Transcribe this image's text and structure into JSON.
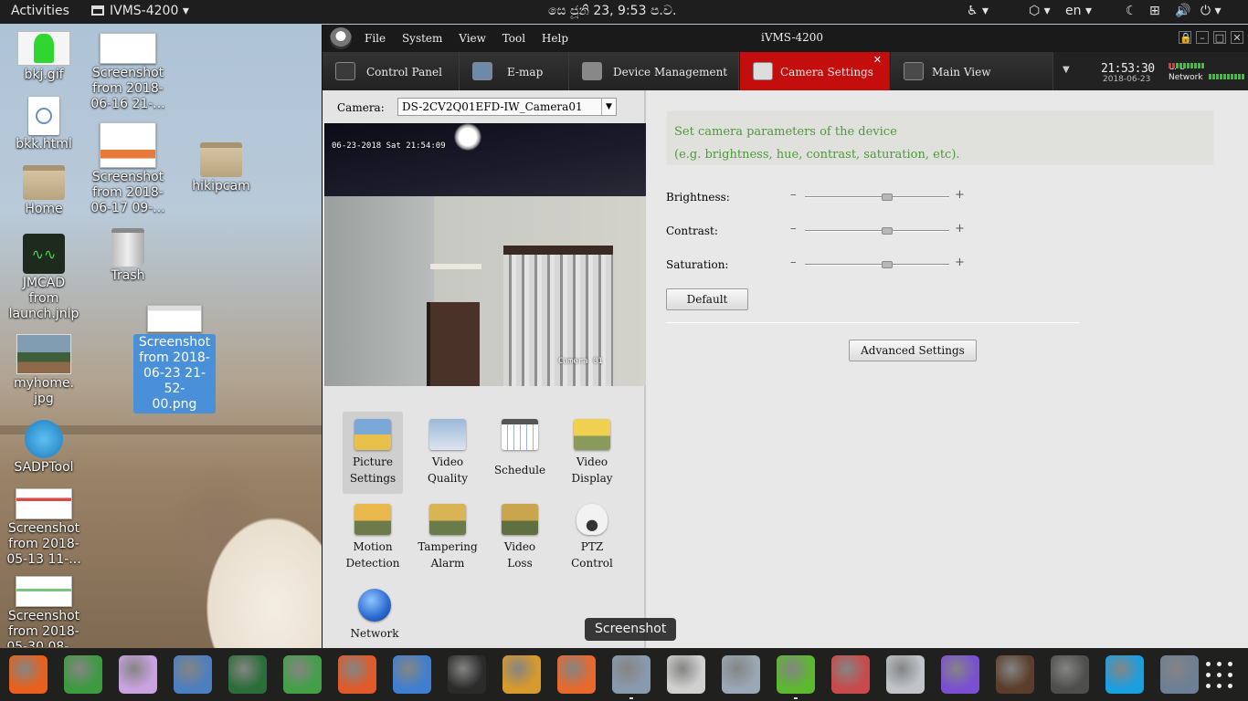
{
  "topbar": {
    "activities": "Activities",
    "app_name": "IVMS-4200",
    "app_menu_arrow": "▾",
    "clock": "සෙ ජූනි  23,  9:53 ප.ව.",
    "lang": "en",
    "lang_arrow": "▾",
    "tray_glyphs": {
      "accessibility": "♿ ▾",
      "dropbox": "⬡ ▾",
      "night": "☾",
      "network": "⊞",
      "volume": "🔊",
      "power": "⏻ ▾"
    }
  },
  "desktop": {
    "icons": [
      {
        "label": "bkj.gif",
        "icon": "image-icon"
      },
      {
        "label": "bkk.html",
        "icon": "html-file-icon"
      },
      {
        "label": "Home",
        "icon": "home-folder-icon"
      },
      {
        "label": "JMCAD\nfrom\nlaunch.jnlp",
        "icon": "jmcad-icon"
      },
      {
        "label": "myhome.\njpg",
        "icon": "photo-icon"
      },
      {
        "label": "SADPTool",
        "icon": "sadptool-icon"
      },
      {
        "label": "Screenshot\nfrom 2018-\n05-13 11-...",
        "icon": "screenshot-file-icon"
      },
      {
        "label": "Screenshot\nfrom 2018-\n05-30 08-...",
        "icon": "screenshot-file-icon"
      },
      {
        "label": "Screenshot\nfrom 2018-\n06-16 21-...",
        "icon": "screenshot-file-icon"
      },
      {
        "label": "Screenshot\nfrom 2018-\n06-17 09-...",
        "icon": "screenshot-file-icon"
      },
      {
        "label": "Trash",
        "icon": "trash-icon"
      },
      {
        "label": "Screenshot\nfrom 2018-\n06-23 21-52-\n00.png",
        "icon": "screenshot-file-icon",
        "selected": true
      },
      {
        "label": "hikipcam",
        "icon": "folder-icon"
      }
    ]
  },
  "window": {
    "title": "iVMS-4200",
    "menu": [
      "File",
      "System",
      "View",
      "Tool",
      "Help"
    ],
    "controls": [
      "🔒",
      "–",
      "□",
      "✕"
    ]
  },
  "tabs": [
    {
      "label": "Control Panel",
      "icon": "control-panel-icon",
      "active": false
    },
    {
      "label": "E-map",
      "icon": "emap-icon",
      "active": false
    },
    {
      "label": "Device Management",
      "icon": "device-management-icon",
      "active": false
    },
    {
      "label": "Camera Settings",
      "icon": "camera-settings-icon",
      "active": true
    },
    {
      "label": "Main View",
      "icon": "main-view-icon",
      "active": false
    }
  ],
  "tab_close": "✕",
  "tab_dropdown": "▼",
  "status": {
    "time": "21:53:30",
    "date": "2018-06-23",
    "cpu_label": "CPU",
    "network_label": "Network"
  },
  "left_pane": {
    "camera_label": "Camera:",
    "camera_value": "DS-2CV2Q01EFD-IW_Camera01",
    "camera_arrow": "▼",
    "osd_time": "06-23-2018 Sat 21:54:09",
    "osd_name": "Camera 01",
    "functions": [
      {
        "label": "Picture\nSettings",
        "icon": "picture-settings-icon",
        "active": true,
        "color": "#e8c14a"
      },
      {
        "label": "Video\nQuality",
        "icon": "video-quality-icon",
        "active": false,
        "color": "#9bb8d8"
      },
      {
        "label": "Schedule",
        "icon": "schedule-icon",
        "active": false,
        "color": "#c9d7ea"
      },
      {
        "label": "Video\nDisplay",
        "icon": "video-display-icon",
        "active": false,
        "color": "#f0d050"
      },
      {
        "label": "Motion\nDetection",
        "icon": "motion-detection-icon",
        "active": false,
        "color": "#e8b84a"
      },
      {
        "label": "Tampering\nAlarm",
        "icon": "tampering-alarm-icon",
        "active": false,
        "color": "#d9b455"
      },
      {
        "label": "Video\nLoss",
        "icon": "video-loss-icon",
        "active": false,
        "color": "#c9a64e"
      },
      {
        "label": "PTZ\nControl",
        "icon": "ptz-control-icon",
        "active": false,
        "color": "#f2f2f2"
      },
      {
        "label": "Network",
        "icon": "network-icon",
        "active": false,
        "color": "#2a6ad0"
      }
    ]
  },
  "right_pane": {
    "description_line1": "Set camera parameters of the device",
    "description_line2": "(e.g. brightness, hue, contrast, saturation, etc).",
    "sliders": [
      {
        "label": "Brightness:",
        "value": 0.57
      },
      {
        "label": "Contrast:",
        "value": 0.57
      },
      {
        "label": "Saturation:",
        "value": 0.57
      }
    ],
    "minus": "–",
    "plus": "+",
    "default_button": "Default",
    "advanced_button": "Advanced Settings"
  },
  "tooltip": "Screenshot",
  "dock": [
    {
      "name": "firefox-icon",
      "color": "#e8601c",
      "running": false
    },
    {
      "name": "chrome-icon",
      "color": "#3c9a3f",
      "running": false
    },
    {
      "name": "shutter-icon",
      "color": "#c9a2e0",
      "running": false
    },
    {
      "name": "file-manager-icon",
      "color": "#4c7fbf",
      "running": false
    },
    {
      "name": "kali-icon",
      "color": "#2b6e3a",
      "running": false
    },
    {
      "name": "spreadsheet-icon",
      "color": "#43a047",
      "running": false
    },
    {
      "name": "presentation-icon",
      "color": "#e05a2a",
      "running": false
    },
    {
      "name": "document-icon",
      "color": "#3f7fd0",
      "running": false
    },
    {
      "name": "terminal-icon",
      "color": "#2b2b2b",
      "running": false
    },
    {
      "name": "settings-tool-icon",
      "color": "#d89a2a",
      "running": false
    },
    {
      "name": "software-center-icon",
      "color": "#e8692c",
      "running": false
    },
    {
      "name": "screenshot-tool-icon",
      "color": "#8a9aae",
      "running": true
    },
    {
      "name": "scanner-icon",
      "color": "#d0d0d0",
      "running": false
    },
    {
      "name": "system-tools-icon",
      "color": "#9aa7b5",
      "running": false
    },
    {
      "name": "ivms-icon",
      "color": "#5cb82f",
      "running": true
    },
    {
      "name": "video-editor-icon",
      "color": "#c84a4a",
      "running": false
    },
    {
      "name": "contacts-icon",
      "color": "#c0c4c8",
      "running": false
    },
    {
      "name": "viber-icon",
      "color": "#7b4fd1",
      "running": false
    },
    {
      "name": "seal-app-icon",
      "color": "#5a3d2a",
      "running": false
    },
    {
      "name": "camera-app-icon",
      "color": "#4e4e4e",
      "running": false
    },
    {
      "name": "skype-icon",
      "color": "#1a9fe0",
      "running": false
    },
    {
      "name": "user-photo-icon",
      "color": "#6c7f94",
      "running": false
    }
  ]
}
